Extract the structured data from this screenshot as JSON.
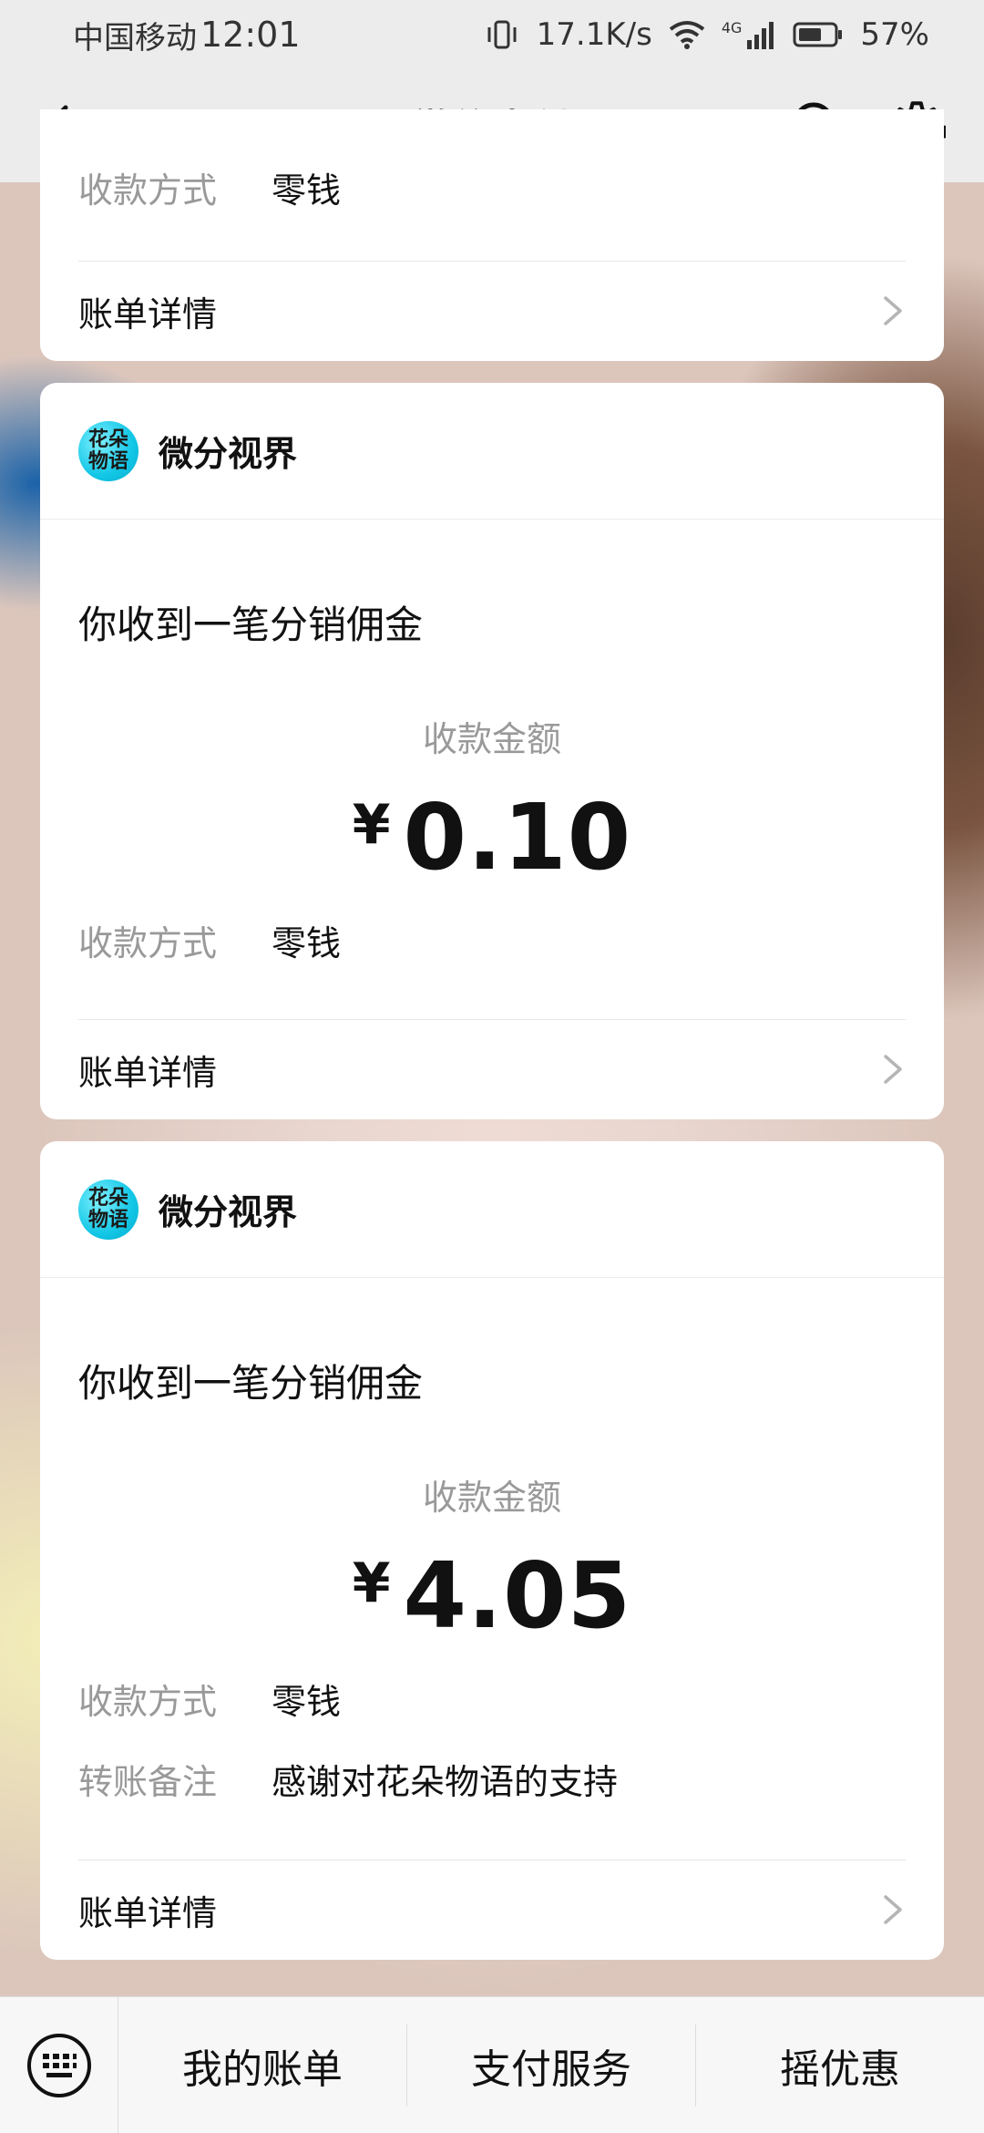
{
  "status_bar": {
    "carrier": "中国移动",
    "time": "12:01",
    "net_speed": "17.1K/s",
    "network": "4G",
    "battery": "57%"
  },
  "header": {
    "title": "微信支付",
    "back_icon": "chevron-left-icon",
    "search_icon": "search-icon",
    "settings_icon": "gear-icon"
  },
  "cards": [
    {
      "partial_row": {
        "key": "收款方式",
        "value": "零钱"
      },
      "detail_label": "账单详情"
    },
    {
      "avatar_text": [
        "花朵",
        "物语"
      ],
      "merchant": "微分视界",
      "notice": "你收到一笔分销佣金",
      "amount_label": "收款金额",
      "currency": "¥",
      "amount": "0.10",
      "rows": [
        {
          "key": "收款方式",
          "value": "零钱"
        }
      ],
      "detail_label": "账单详情"
    },
    {
      "avatar_text": [
        "花朵",
        "物语"
      ],
      "merchant": "微分视界",
      "notice": "你收到一笔分销佣金",
      "amount_label": "收款金额",
      "currency": "¥",
      "amount": "4.05",
      "rows": [
        {
          "key": "收款方式",
          "value": "零钱"
        },
        {
          "key": "转账备注",
          "value": "感谢对花朵物语的支持"
        }
      ],
      "detail_label": "账单详情"
    }
  ],
  "bottom_bar": {
    "keyboard_icon": "keyboard-icon",
    "items": [
      "我的账单",
      "支付服务",
      "摇优惠"
    ]
  },
  "colors": {
    "avatar": "#12c7e6",
    "muted_text": "#999999",
    "card_bg": "#ffffff",
    "header_bg": "#ececec"
  }
}
